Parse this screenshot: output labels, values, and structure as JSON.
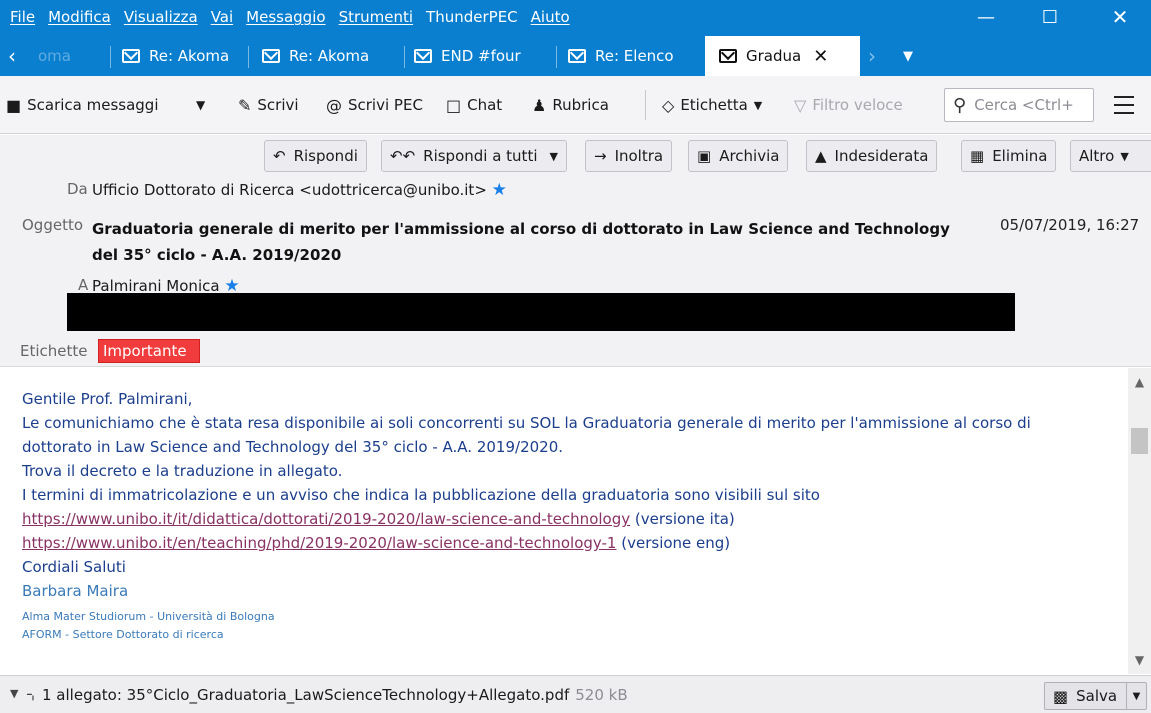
{
  "menu": [
    "File",
    "Modifica",
    "Visualizza",
    "Vai",
    "Messaggio",
    "Strumenti",
    "ThunderPEC",
    "Aiuto"
  ],
  "window_controls": {
    "minimize": "—",
    "maximize": "☐",
    "close": "✕"
  },
  "tabs": [
    {
      "label": "oma"
    },
    {
      "label": "Re: Akoma"
    },
    {
      "label": "Re: Akoma"
    },
    {
      "label": "END #four"
    },
    {
      "label": "Re: Elenco"
    },
    {
      "label": "Gradua",
      "active": true
    }
  ],
  "toolbar": {
    "get_messages": "Scarica messaggi",
    "write": "Scrivi",
    "write_pec": "Scrivi PEC",
    "chat": "Chat",
    "address_book": "Rubrica",
    "tag": "Etichetta",
    "quick_filter": "Filtro veloce",
    "search_placeholder": "Cerca <Ctrl+"
  },
  "actions": {
    "reply": "Rispondi",
    "reply_all": "Rispondi a tutti",
    "forward": "Inoltra",
    "archive": "Archivia",
    "junk": "Indesiderata",
    "delete": "Elimina",
    "more": "Altro"
  },
  "header": {
    "from_label": "Da",
    "from_value": "Ufficio Dottorato di Ricerca <udottricerca@unibo.it>",
    "subject_label": "Oggetto",
    "subject_value": "Graduatoria generale di merito per l'ammissione al corso di dottorato in Law Science and Technology del 35° ciclo - A.A. 2019/2020",
    "date": "05/07/2019, 16:27",
    "to_label": "A",
    "to_value": "Palmirani Monica",
    "tags_label": "Etichette",
    "tag_value": "Importante"
  },
  "body": {
    "greeting": "Gentile Prof. Palmirani,",
    "line1": "Le comunichiamo che è stata resa disponibile ai soli concorrenti su SOL la Graduatoria generale di merito per l'ammissione al corso di",
    "line2": "dottorato in Law Science and Technology del 35° ciclo - A.A. 2019/2020.",
    "line3": "Trova il decreto e la traduzione in allegato.",
    "line4": "I termini di immatricolazione e un avviso che indica la pubblicazione della graduatoria sono visibili  sul sito",
    "link_ita": "https://www.unibo.it/it/didattica/dottorati/2019-2020/law-science-and-technology",
    "link_ita_suffix": " (versione ita)",
    "link_eng": "https://www.unibo.it/en/teaching/phd/2019-2020/law-science-and-technology-1",
    "link_eng_suffix": " (versione eng)",
    "closing": "Cordiali Saluti",
    "sig_name": "Barbara Maira",
    "sig_org": "Alma Mater Studiorum - Università di Bologna",
    "sig_dept": "AFORM - Settore Dottorato di ricerca"
  },
  "attachment": {
    "text": "1 allegato: 35°Ciclo_Graduatoria_LawScienceTechnology+Allegato.pdf",
    "size": "520 kB",
    "save": "Salva"
  },
  "colors": {
    "titlebar": "#0a7fd0",
    "tag_important": "#f03c3c",
    "link": "#8a3264",
    "body_text": "#1c3e8c"
  }
}
